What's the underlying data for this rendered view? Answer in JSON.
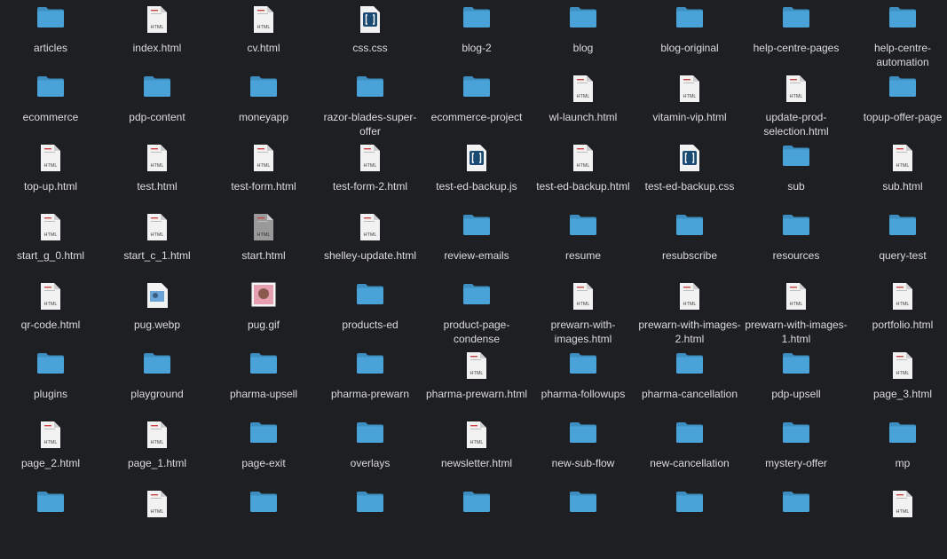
{
  "colors": {
    "background": "#1e1f22",
    "folder": "#4aa3d8",
    "folder_tab": "#3d8fc2",
    "doc": "#f2f2f2",
    "text": "#dcdcdc"
  },
  "doc_tag": "HTML",
  "items": [
    {
      "label": "articles",
      "kind": "folder"
    },
    {
      "label": "index.html",
      "kind": "html"
    },
    {
      "label": "cv.html",
      "kind": "html"
    },
    {
      "label": "css.css",
      "kind": "code"
    },
    {
      "label": "blog-2",
      "kind": "folder"
    },
    {
      "label": "blog",
      "kind": "folder"
    },
    {
      "label": "blog-original",
      "kind": "folder"
    },
    {
      "label": "help-centre-pages",
      "kind": "folder"
    },
    {
      "label": "help-centre-automation",
      "kind": "folder"
    },
    {
      "label": "ecommerce",
      "kind": "folder"
    },
    {
      "label": "pdp-content",
      "kind": "folder"
    },
    {
      "label": "moneyapp",
      "kind": "folder"
    },
    {
      "label": "razor-blades-super-offer",
      "kind": "folder"
    },
    {
      "label": "ecommerce-project",
      "kind": "folder"
    },
    {
      "label": "wl-launch.html",
      "kind": "html"
    },
    {
      "label": "vitamin-vip.html",
      "kind": "html"
    },
    {
      "label": "update-prod-selection.html",
      "kind": "html"
    },
    {
      "label": "topup-offer-page",
      "kind": "folder"
    },
    {
      "label": "top-up.html",
      "kind": "html"
    },
    {
      "label": "test.html",
      "kind": "html"
    },
    {
      "label": "test-form.html",
      "kind": "html"
    },
    {
      "label": "test-form-2.html",
      "kind": "html"
    },
    {
      "label": "test-ed-backup.js",
      "kind": "code"
    },
    {
      "label": "test-ed-backup.html",
      "kind": "html"
    },
    {
      "label": "test-ed-backup.css",
      "kind": "code"
    },
    {
      "label": "sub",
      "kind": "folder"
    },
    {
      "label": "sub.html",
      "kind": "html"
    },
    {
      "label": "start_g_0.html",
      "kind": "html"
    },
    {
      "label": "start_c_1.html",
      "kind": "html"
    },
    {
      "label": "start.html",
      "kind": "html-dark"
    },
    {
      "label": "shelley-update.html",
      "kind": "html"
    },
    {
      "label": "review-emails",
      "kind": "folder"
    },
    {
      "label": "resume",
      "kind": "folder"
    },
    {
      "label": "resubscribe",
      "kind": "folder"
    },
    {
      "label": "resources",
      "kind": "folder"
    },
    {
      "label": "query-test",
      "kind": "folder"
    },
    {
      "label": "qr-code.html",
      "kind": "html"
    },
    {
      "label": "pug.webp",
      "kind": "image"
    },
    {
      "label": "pug.gif",
      "kind": "image-pink"
    },
    {
      "label": "products-ed",
      "kind": "folder"
    },
    {
      "label": "product-page-condense",
      "kind": "folder"
    },
    {
      "label": "prewarn-with-images.html",
      "kind": "html"
    },
    {
      "label": "prewarn-with-images-2.html",
      "kind": "html"
    },
    {
      "label": "prewarn-with-images-1.html",
      "kind": "html"
    },
    {
      "label": "portfolio.html",
      "kind": "html"
    },
    {
      "label": "plugins",
      "kind": "folder"
    },
    {
      "label": "playground",
      "kind": "folder"
    },
    {
      "label": "pharma-upsell",
      "kind": "folder"
    },
    {
      "label": "pharma-prewarn",
      "kind": "folder"
    },
    {
      "label": "pharma-prewarn.html",
      "kind": "html"
    },
    {
      "label": "pharma-followups",
      "kind": "folder"
    },
    {
      "label": "pharma-cancellation",
      "kind": "folder"
    },
    {
      "label": "pdp-upsell",
      "kind": "folder"
    },
    {
      "label": "page_3.html",
      "kind": "html"
    },
    {
      "label": "page_2.html",
      "kind": "html"
    },
    {
      "label": "page_1.html",
      "kind": "html"
    },
    {
      "label": "page-exit",
      "kind": "folder"
    },
    {
      "label": "overlays",
      "kind": "folder"
    },
    {
      "label": "newsletter.html",
      "kind": "html"
    },
    {
      "label": "new-sub-flow",
      "kind": "folder"
    },
    {
      "label": "new-cancellation",
      "kind": "folder"
    },
    {
      "label": "mystery-offer",
      "kind": "folder"
    },
    {
      "label": "mp",
      "kind": "folder"
    },
    {
      "label": "",
      "kind": "folder"
    },
    {
      "label": "",
      "kind": "html"
    },
    {
      "label": "",
      "kind": "folder"
    },
    {
      "label": "",
      "kind": "folder"
    },
    {
      "label": "",
      "kind": "folder"
    },
    {
      "label": "",
      "kind": "folder"
    },
    {
      "label": "",
      "kind": "folder"
    },
    {
      "label": "",
      "kind": "folder"
    },
    {
      "label": "",
      "kind": "html"
    }
  ]
}
